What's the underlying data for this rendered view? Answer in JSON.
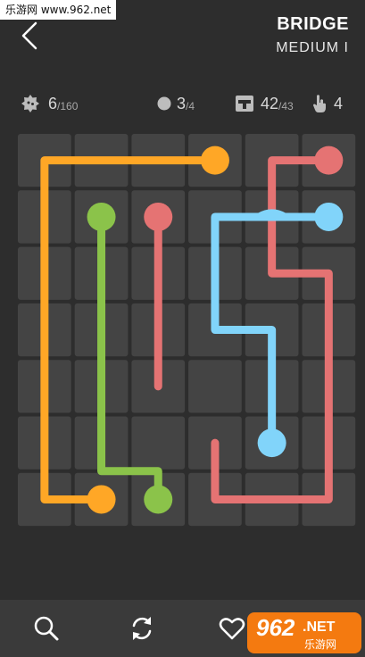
{
  "watermark": "乐游网 www.962.net",
  "header": {
    "title": "BRIDGE",
    "subtitle": "MEDIUM I"
  },
  "stats": {
    "levels": {
      "value": "6",
      "total": "/160",
      "icon": "gear-badge-icon"
    },
    "flows": {
      "value": "3",
      "total": "/4",
      "icon": "dot-icon"
    },
    "pipe": {
      "value": "42",
      "total": "/43",
      "icon": "pipe-icon"
    },
    "moves": {
      "value": "4",
      "icon": "hand-icon"
    }
  },
  "board": {
    "cols": 6,
    "rows": 7,
    "colors": {
      "orange": "#ffa726",
      "green": "#8bc34a",
      "red": "#e57373",
      "blue": "#81d4fa",
      "cell": "#444444",
      "cell_dark": "#3b3b3b"
    },
    "flows": [
      {
        "color": "orange",
        "cells": [
          [
            3,
            0
          ],
          [
            2,
            0
          ],
          [
            1,
            0
          ],
          [
            0,
            0
          ],
          [
            0,
            1
          ],
          [
            0,
            2
          ],
          [
            0,
            3
          ],
          [
            0,
            4
          ],
          [
            0,
            5
          ],
          [
            0,
            6
          ],
          [
            1,
            6
          ]
        ]
      },
      {
        "color": "green",
        "cells": [
          [
            1,
            1
          ]
        ],
        "extra": [
          [
            1,
            2.85
          ],
          [
            1,
            5.5
          ],
          [
            2,
            5.5
          ],
          [
            2,
            6
          ]
        ]
      },
      {
        "color": "red",
        "cells": [
          [
            2,
            1
          ],
          [
            2,
            2
          ],
          [
            2,
            3
          ],
          [
            2,
            4
          ]
        ],
        "endpoints": [
          [
            2,
            1
          ]
        ]
      },
      {
        "color": "red",
        "cells": [
          [
            5,
            0
          ],
          [
            4,
            0
          ],
          [
            4,
            1
          ],
          [
            4,
            2
          ],
          [
            5,
            2
          ],
          [
            5,
            3
          ],
          [
            5,
            4
          ],
          [
            5,
            5
          ],
          [
            5,
            6
          ],
          [
            4,
            6
          ],
          [
            3,
            6
          ],
          [
            3,
            5
          ]
        ],
        "endpoints": [
          [
            5,
            0
          ]
        ]
      },
      {
        "color": "blue",
        "cells": [
          [
            5,
            1
          ],
          [
            4,
            1
          ],
          [
            3,
            1
          ],
          [
            3,
            2
          ],
          [
            3,
            3
          ],
          [
            4,
            3
          ],
          [
            4,
            4
          ],
          [
            4,
            5
          ]
        ],
        "endpoints": [
          [
            5,
            1
          ],
          [
            4,
            5
          ]
        ]
      }
    ],
    "endpoints": [
      {
        "color": "orange",
        "col": 3,
        "row": 0
      },
      {
        "color": "orange",
        "col": 1,
        "row": 6
      },
      {
        "color": "green",
        "col": 1,
        "row": 1
      },
      {
        "color": "green",
        "col": 2,
        "row": 6
      },
      {
        "color": "red",
        "col": 2,
        "row": 1
      },
      {
        "color": "red",
        "col": 5,
        "row": 0
      },
      {
        "color": "blue",
        "col": 5,
        "row": 1
      },
      {
        "color": "blue",
        "col": 4,
        "row": 5
      }
    ],
    "bridge_cell": {
      "col": 4,
      "row": 1
    }
  },
  "toolbar": {
    "search_icon": "search-icon",
    "restart_icon": "restart-icon",
    "favorite_icon": "heart-icon"
  },
  "logo": {
    "number": "962",
    "suffix": ".NET",
    "cn": "乐游网"
  }
}
